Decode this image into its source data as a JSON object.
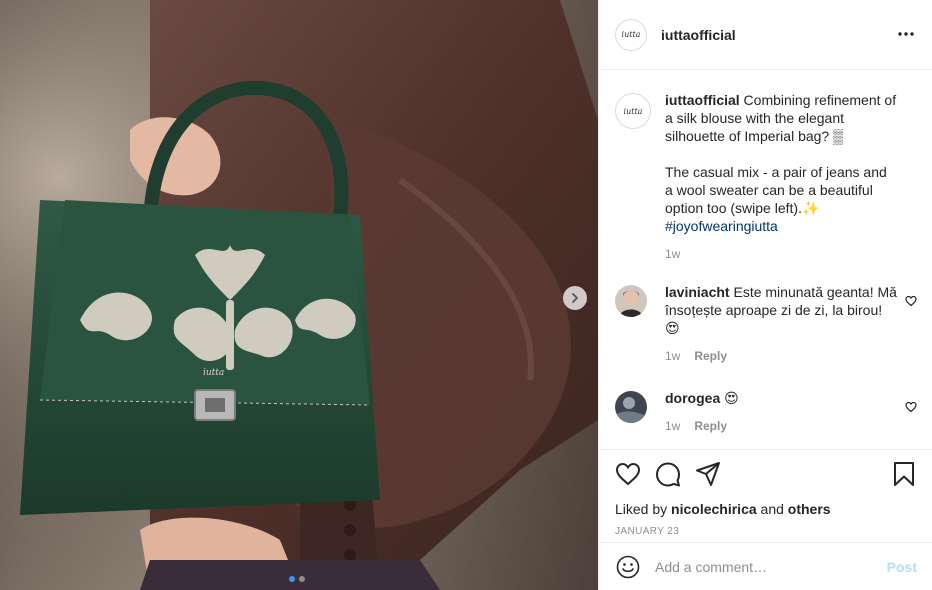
{
  "post": {
    "username": "iuttaofficial",
    "avatar_logo_text": "iutta",
    "image": {
      "description_icon": "photo-green-handbag",
      "bag_logo_text": "iutta",
      "carousel_total": 2,
      "carousel_active": 1
    }
  },
  "caption": {
    "username": "iuttaofficial",
    "text": " Combining refinement of a silk blouse with the elegant silhouette of Imperial bag? ▒",
    "text2": "The casual mix - a pair of jeans and a wool sweater can be a beautiful option too (swipe left).✨ ",
    "hashtag": "#joyofwearingiutta",
    "time": "1w"
  },
  "comments": [
    {
      "username": "laviniacht",
      "text": " Este minunată geanta! Mă însoțește aproape zi de zi, la birou! 😍",
      "time": "1w",
      "reply": "Reply"
    },
    {
      "username": "dorogea",
      "text": " 😍",
      "time": "1w",
      "reply": "Reply"
    }
  ],
  "likes": {
    "prefix": "Liked by ",
    "user": "nicolechirica",
    "middle": " and ",
    "others": "others"
  },
  "date": "JANUARY 23",
  "add_comment": {
    "placeholder": "Add a comment…",
    "post_label": "Post"
  },
  "colors": {
    "accent": "#3897f0",
    "post_disabled": "#b2dffc",
    "hashtag": "#00376b",
    "bag_green": "#254a38"
  }
}
